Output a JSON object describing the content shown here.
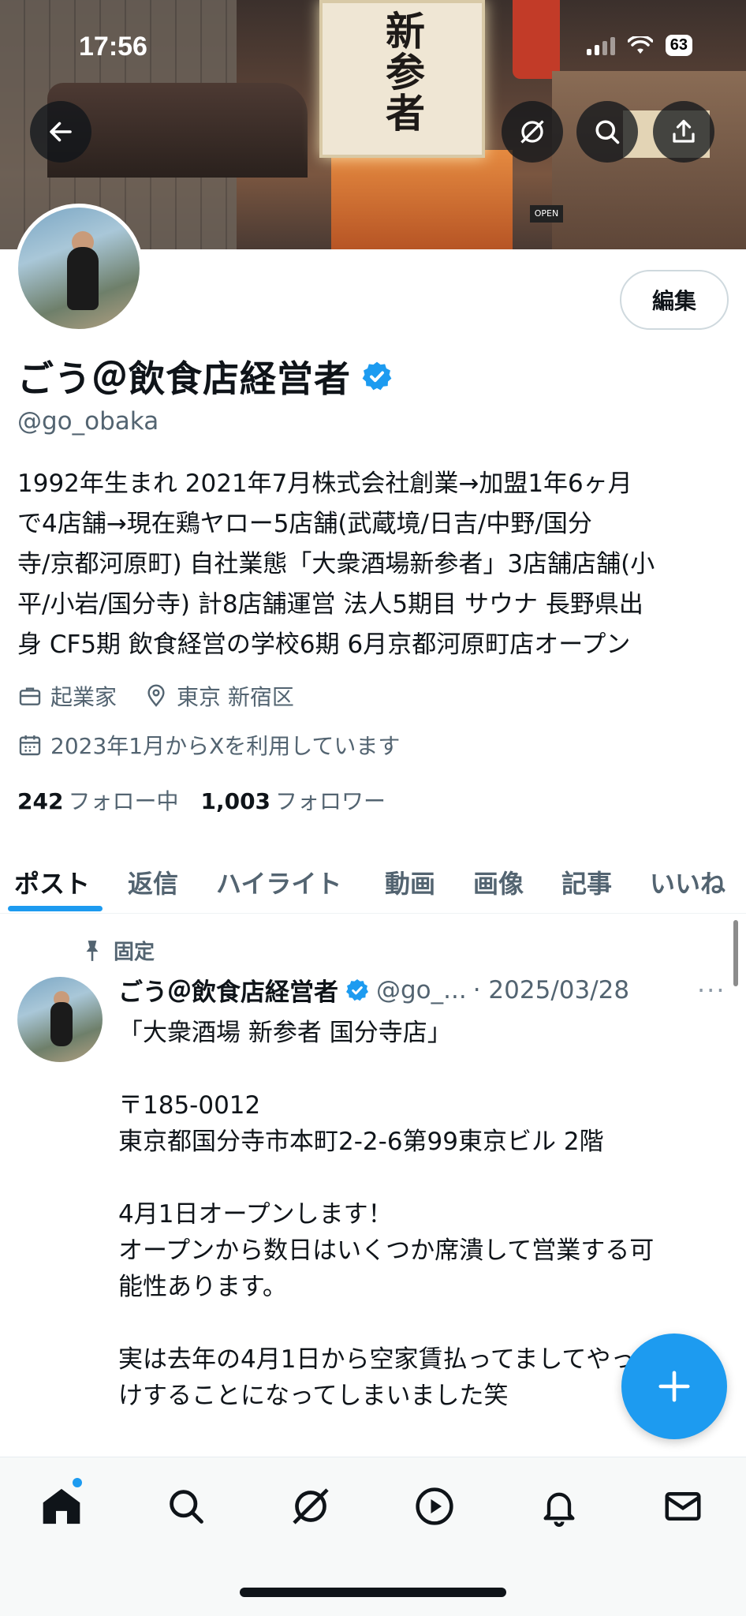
{
  "status_bar": {
    "time": "17:56",
    "battery": "63"
  },
  "banner": {
    "sign_text": "新参者",
    "open_text": "OPEN"
  },
  "profile": {
    "edit_label": "編集",
    "name": "ごう＠飲食店経営者",
    "handle": "@go_obaka",
    "bio_lines": [
      "1992年生まれ 2021年7月株式会社創業→加盟1年6ヶ月",
      "で4店舗→現在鶏ヤロー5店舗(武蔵境/日吉/中野/国分",
      "寺/京都河原町) 自社業態「大衆酒場新参者」3店舗店舗(小",
      "平/小岩/国分寺) 計8店舗運営 法人5期目 サウナ 長野県出",
      "身 CF5期 飲食経営の学校6期 6月京都河原町店オープン"
    ],
    "occupation": "起業家",
    "location": "東京 新宿区",
    "joined": "2023年1月からXを利用しています",
    "following_count": "242",
    "following_label": "フォロー中",
    "followers_count": "1,003",
    "followers_label": "フォロワー"
  },
  "tabs": [
    "ポスト",
    "返信",
    "ハイライト",
    "動画",
    "画像",
    "記事",
    "いいね"
  ],
  "active_tab": "ポスト",
  "post": {
    "pinned_label": "固定",
    "author_name": "ごう＠飲食店経営者",
    "author_handle": "@go_...",
    "date": "· 2025/03/28",
    "more": "···",
    "body": "「大衆酒場 新参者 国分寺店」\n\n〒185-0012\n東京都国分寺市本町2-2-6第99東京ビル 2階\n\n4月1日オープンします！\nオープンから数日はいくつか席潰して営業する可\n能性あります。\n\n実は去年の4月1日から空家賃払ってましてやっと開\nけすることになってしまいました笑"
  },
  "fab": {
    "label": "+"
  },
  "colors": {
    "accent": "#1d9bf0",
    "text": "#0f1419",
    "secondary": "#536471"
  }
}
